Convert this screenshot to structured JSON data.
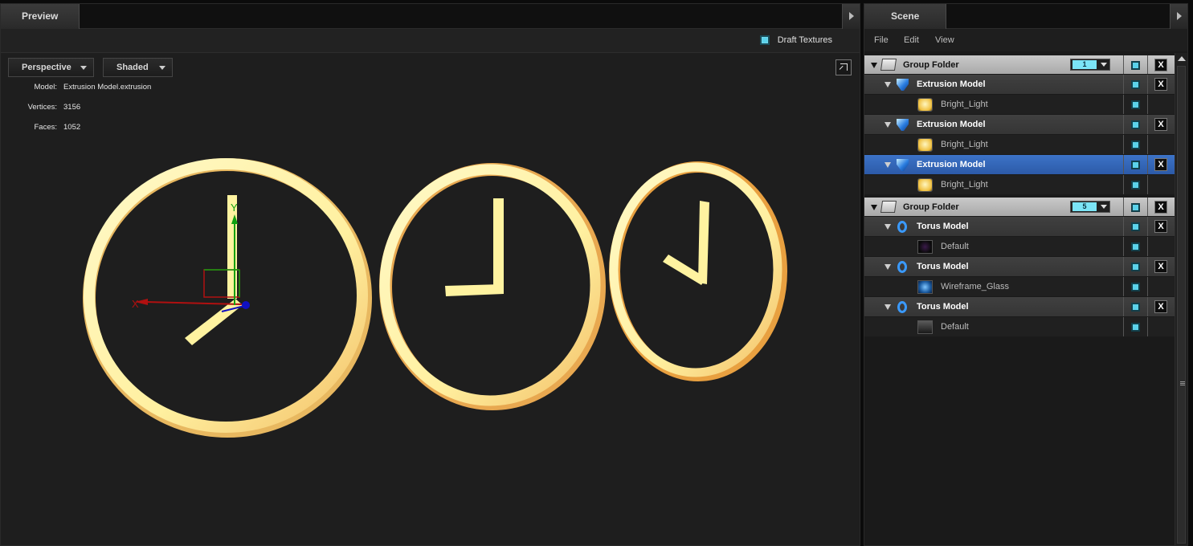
{
  "preview": {
    "tab_label": "Preview",
    "draft_textures_label": "Draft Textures",
    "view_mode": "Perspective",
    "shading_mode": "Shaded",
    "info": {
      "model_label": "Model:",
      "model_value": "Extrusion Model.extrusion",
      "vertices_label": "Vertices:",
      "vertices_value": "3156",
      "faces_label": "Faces:",
      "faces_value": "1052"
    },
    "axis": {
      "x_label": "X",
      "y_label": "Y"
    },
    "colors": {
      "ring": "#fff3a0",
      "ring_shade": "#f0b85a",
      "axis_x": "#b01010",
      "axis_y": "#10a010",
      "axis_z": "#1010c0"
    }
  },
  "scene": {
    "tab_label": "Scene",
    "menu": [
      "File",
      "Edit",
      "View"
    ],
    "accent": "#5bd2ea",
    "selection_color": "#3c73c7",
    "rows": [
      {
        "type": "group",
        "name": "Group Folder",
        "count": "1"
      },
      {
        "type": "model",
        "icon": "extrusion-icon",
        "name": "Extrusion Model",
        "selected": false
      },
      {
        "type": "material",
        "swatch": "light",
        "name": "Bright_Light"
      },
      {
        "type": "model",
        "icon": "extrusion-icon",
        "name": "Extrusion Model",
        "selected": false
      },
      {
        "type": "material",
        "swatch": "light",
        "name": "Bright_Light"
      },
      {
        "type": "model",
        "icon": "extrusion-icon",
        "name": "Extrusion Model",
        "selected": true
      },
      {
        "type": "material",
        "swatch": "light",
        "name": "Bright_Light"
      },
      {
        "type": "group",
        "name": "Group Folder",
        "count": "5"
      },
      {
        "type": "model",
        "icon": "torus-icon",
        "name": "Torus Model",
        "selected": false
      },
      {
        "type": "material",
        "swatch": "default",
        "name": "Default"
      },
      {
        "type": "model",
        "icon": "torus-icon",
        "name": "Torus Model",
        "selected": false
      },
      {
        "type": "material",
        "swatch": "wire",
        "name": "Wireframe_Glass"
      },
      {
        "type": "model",
        "icon": "torus-icon",
        "name": "Torus Model",
        "selected": false
      },
      {
        "type": "material",
        "swatch": "default2",
        "name": "Default"
      }
    ],
    "delete_label": "X"
  }
}
